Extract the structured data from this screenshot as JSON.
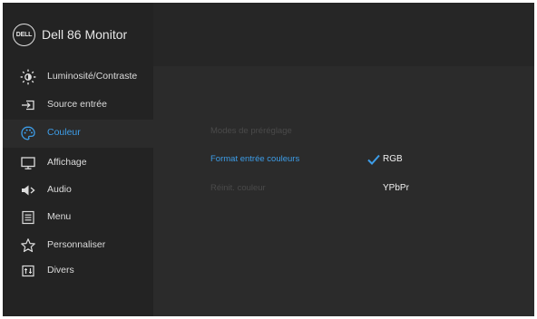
{
  "header": {
    "logo_text": "DELL",
    "title": "Dell 86 Monitor"
  },
  "sidebar": {
    "items": [
      {
        "label": "Luminosité/Contraste",
        "icon": "brightness-icon",
        "active": false
      },
      {
        "label": "Source entrée",
        "icon": "input-source-icon",
        "active": false
      },
      {
        "label": "Couleur",
        "icon": "palette-icon",
        "active": true
      },
      {
        "label": "Affichage",
        "icon": "display-icon",
        "active": false
      },
      {
        "label": "Audio",
        "icon": "speaker-icon",
        "active": false
      },
      {
        "label": "Menu",
        "icon": "menu-icon",
        "active": false
      },
      {
        "label": "Personnaliser",
        "icon": "star-icon",
        "active": false
      },
      {
        "label": "Divers",
        "icon": "misc-icon",
        "active": false
      }
    ]
  },
  "content": {
    "options": [
      {
        "label": "Modes de préréglage",
        "state": "disabled"
      },
      {
        "label": "Format entrée couleurs",
        "state": "selected"
      },
      {
        "label": "Réinit. couleur",
        "state": "disabled"
      }
    ],
    "values": [
      {
        "label": "RGB",
        "checked": true
      },
      {
        "label": "YPbPr",
        "checked": false
      }
    ]
  },
  "colors": {
    "accent": "#3d9de8",
    "background": "#1e1e1e",
    "panel": "#2b2b2b",
    "disabled": "#4a4a4a"
  }
}
